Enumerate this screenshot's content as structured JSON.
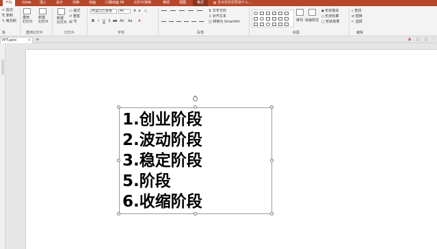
{
  "tabs": [
    {
      "label": "开始",
      "active": true
    },
    {
      "label": "iSlide"
    },
    {
      "label": "插入"
    },
    {
      "label": "设计"
    },
    {
      "label": "切换"
    },
    {
      "label": "动画"
    },
    {
      "label": "口袋动画 PA"
    },
    {
      "label": "幻灯片放映"
    },
    {
      "label": "审阅"
    },
    {
      "label": "视图"
    },
    {
      "label": "格式",
      "format": true
    }
  ],
  "tell_me": "告诉我您想要做什么...",
  "ribbon": {
    "clipboard": {
      "cut": "剪切",
      "copy": "复制",
      "format_painter": "格式刷",
      "label": "板"
    },
    "slides_group1": {
      "reuse": "重用\n幻灯片",
      "new_slide": "新建\n幻灯片",
      "label": "重用幻灯片"
    },
    "slides_group2": {
      "new_slide": "新建\n幻灯片",
      "layout": "版式",
      "reset": "重置",
      "section": "节",
      "label": "幻灯片"
    },
    "font": {
      "family": "阿里巴巴普惠",
      "size": "40",
      "buttons": [
        "B",
        "I",
        "U",
        "S",
        "ab",
        "AV",
        "Aa",
        "A"
      ],
      "label": "字体"
    },
    "paragraph": {
      "text_direction": "文字方向",
      "align_text": "对齐文本",
      "convert_smartart": "转换为 SmartArt",
      "label": "段落"
    },
    "drawing": {
      "arrange": "排列",
      "quick_styles": "快速样式",
      "shape_fill": "形状填充",
      "shape_outline": "形状轮廓",
      "shape_effects": "形状效果",
      "label": "绘图"
    },
    "editing": {
      "find": "查找",
      "replace": "替换",
      "select": "选择",
      "label": "编辑"
    }
  },
  "document_tab": "PPT.pptx",
  "slide": {
    "lines": [
      "1.创业阶段",
      "2.波动阶段",
      "3.稳定阶段",
      "5.阶段",
      "6.收缩阶段"
    ]
  },
  "colors": {
    "accent": "#b7472a",
    "ribbon_bg": "#f3f3f3",
    "canvas_bg": "#e6e6e6"
  }
}
